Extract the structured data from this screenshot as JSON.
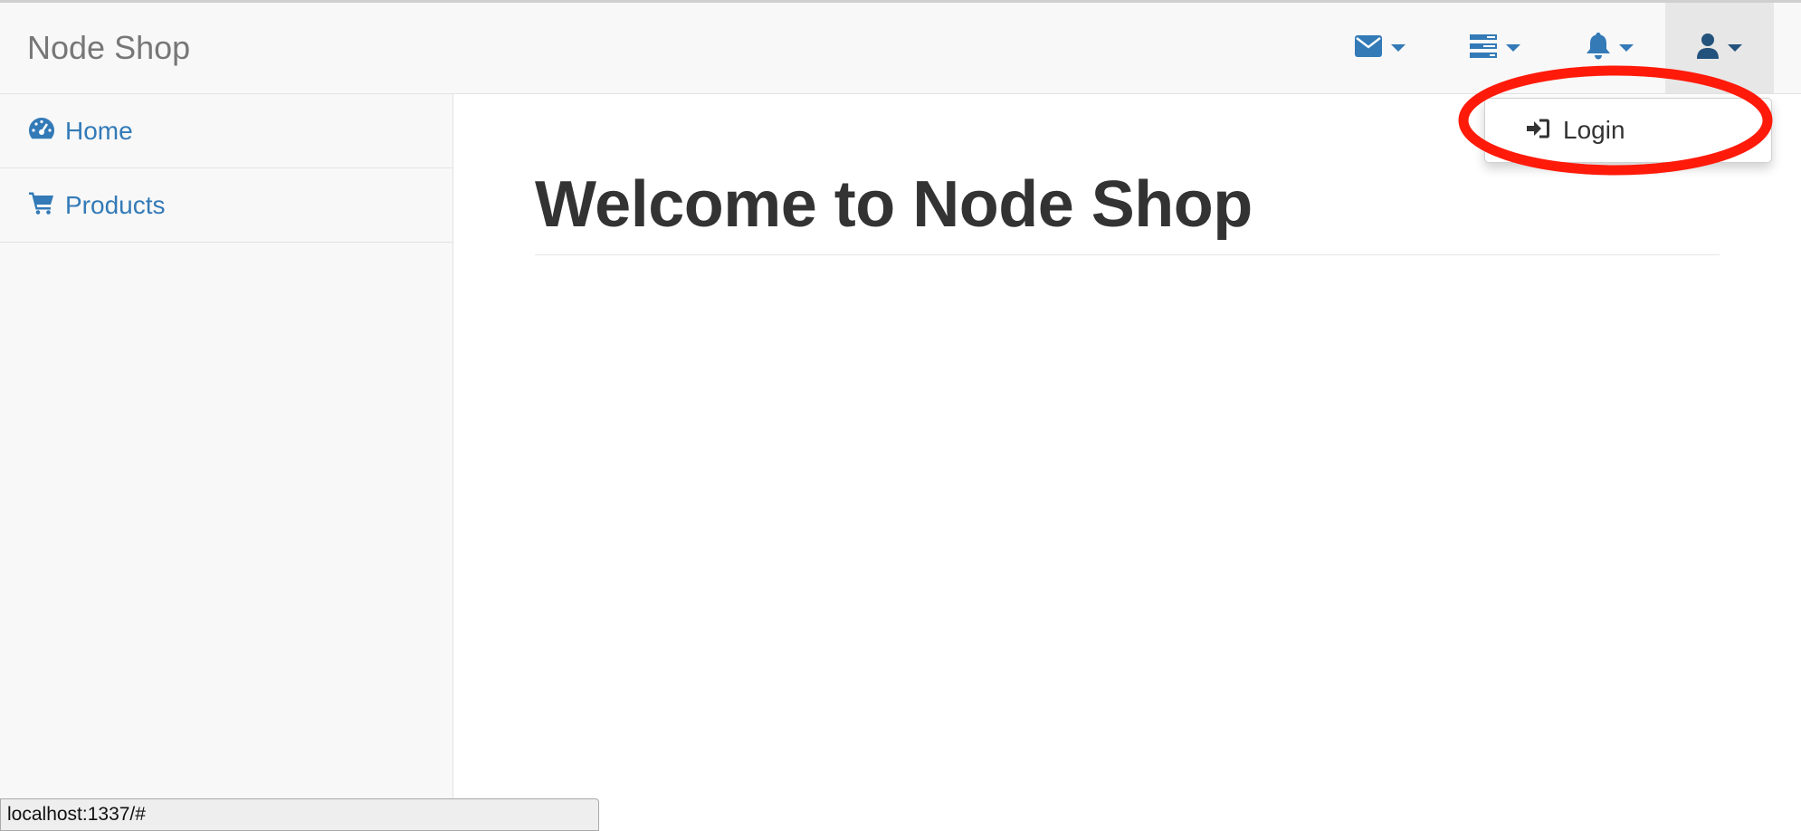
{
  "brand": "Node Shop",
  "navbar": {
    "icons": [
      {
        "name": "envelope-icon"
      },
      {
        "name": "tasks-icon"
      },
      {
        "name": "bell-icon"
      },
      {
        "name": "user-icon"
      }
    ],
    "accent_color": "#337ab7"
  },
  "sidebar": {
    "items": [
      {
        "label": "Home",
        "icon": "dashboard-icon"
      },
      {
        "label": "Products",
        "icon": "shopping-cart-icon"
      }
    ]
  },
  "main": {
    "title": "Welcome to Node Shop"
  },
  "user_dropdown": {
    "items": [
      {
        "label": "Login",
        "icon": "sign-in-icon"
      }
    ],
    "highlight_color": "#ff1a0a"
  },
  "status_bar": {
    "url": "localhost:1337/#"
  }
}
